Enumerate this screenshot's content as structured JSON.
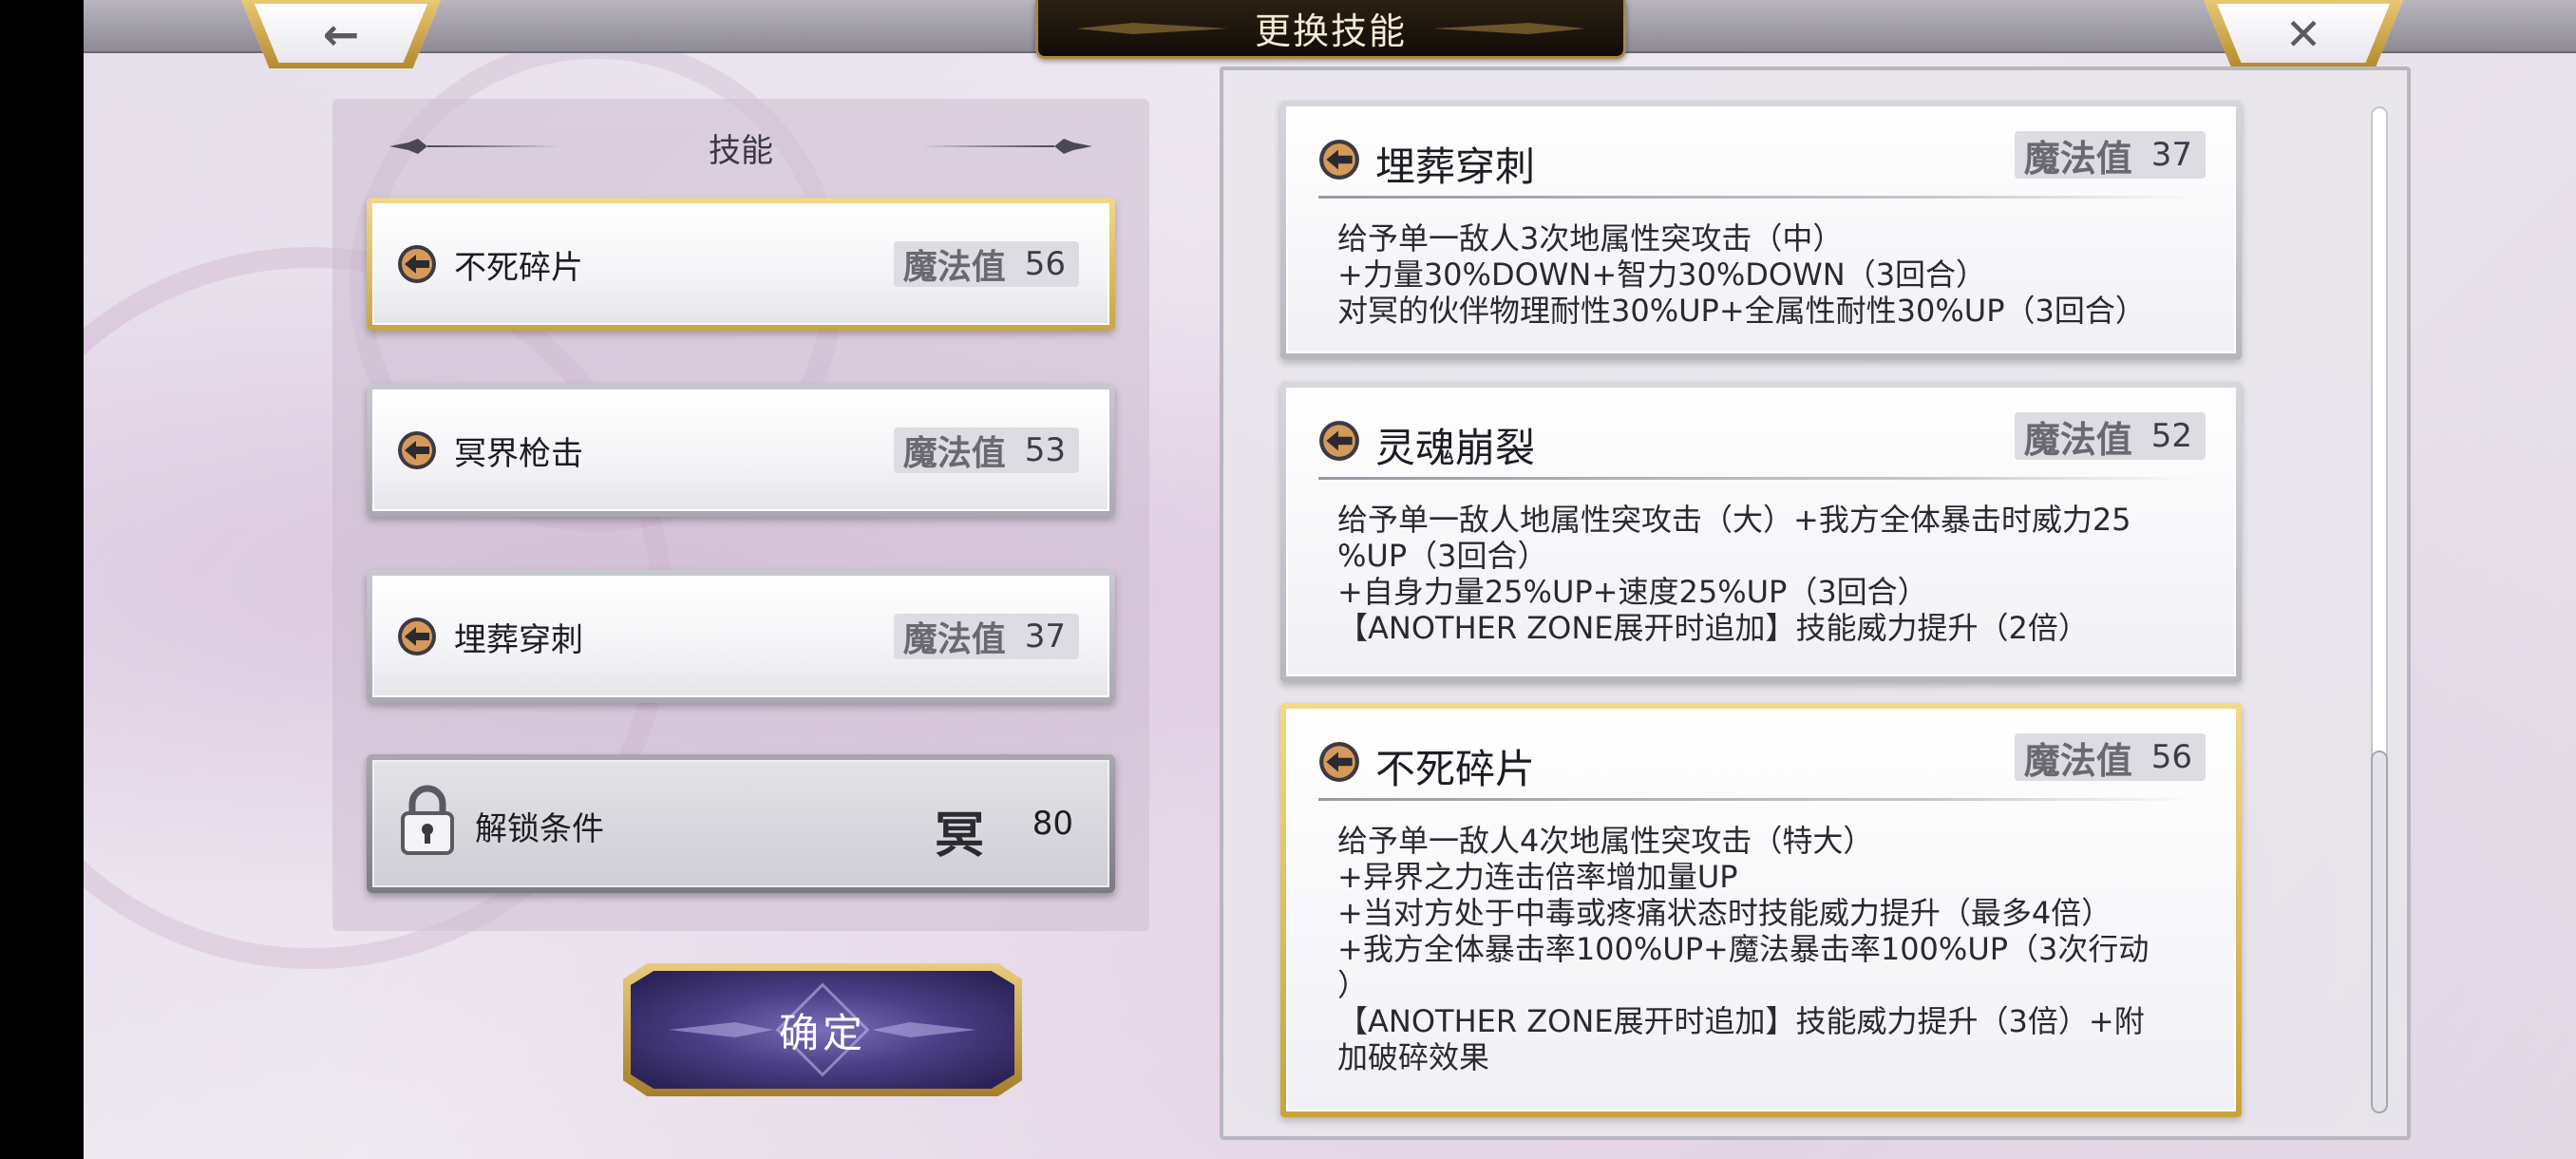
{
  "header": {
    "title": "更换技能",
    "back_glyph": "←",
    "close_glyph": "✕"
  },
  "left_panel": {
    "title": "技能",
    "skills": [
      {
        "name": "不死碎片",
        "mp_label": "魔法值",
        "mp": "56",
        "selected": true
      },
      {
        "name": "冥界枪击",
        "mp_label": "魔法值",
        "mp": "53",
        "selected": false
      },
      {
        "name": "埋葬穿刺",
        "mp_label": "魔法值",
        "mp": "37",
        "selected": false
      }
    ],
    "locked": {
      "label": "解锁条件",
      "glyph": "冥",
      "value": "80"
    }
  },
  "confirm": {
    "label": "确定"
  },
  "details": [
    {
      "name": "埋葬穿刺",
      "mp_label": "魔法值",
      "mp": "37",
      "lines": [
        "给予单一敌人3次地属性突攻击（中）",
        "+力量30%DOWN+智力30%DOWN（3回合）",
        "对冥的伙伴物理耐性30%UP+全属性耐性30%UP（3回合）"
      ]
    },
    {
      "name": "灵魂崩裂",
      "mp_label": "魔法值",
      "mp": "52",
      "lines": [
        "给予单一敌人地属性突攻击（大）+我方全体暴击时威力25",
        "%UP（3回合）",
        "+自身力量25%UP+速度25%UP（3回合）",
        "【ANOTHER ZONE展开时追加】技能威力提升（2倍）"
      ]
    },
    {
      "name": "不死碎片",
      "mp_label": "魔法值",
      "mp": "56",
      "selected": true,
      "lines": [
        "给予单一敌人4次地属性突攻击（特大）",
        "+异界之力连击倍率增加量UP",
        "+当对方处于中毒或疼痛状态时技能威力提升（最多4倍）",
        "+我方全体暴击率100%UP+魔法暴击率100%UP（3次行动",
        "）",
        "【ANOTHER ZONE展开时追加】技能威力提升（3倍）+附",
        "加破碎效果"
      ]
    }
  ],
  "colors": {
    "gold": "#c9a446",
    "title_bg": "#1a120a",
    "confirm_purple": "#4a3f86"
  },
  "icons": [
    "back-arrow-icon",
    "close-icon",
    "skill-arrow-icon",
    "lock-icon"
  ]
}
